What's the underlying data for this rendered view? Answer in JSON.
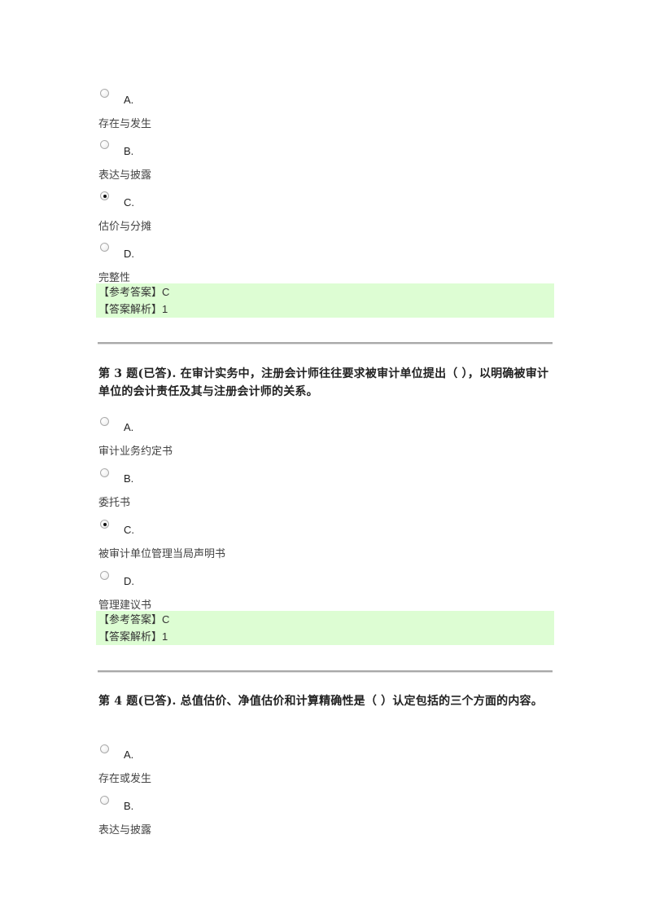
{
  "questions": [
    {
      "title": "",
      "options": [
        {
          "letter": "A.",
          "text": "存在与发生",
          "selected": false
        },
        {
          "letter": "B.",
          "text": "表达与披露",
          "selected": false
        },
        {
          "letter": "C.",
          "text": "估价与分摊",
          "selected": true
        },
        {
          "letter": "D.",
          "text": "完整性",
          "selected": false
        }
      ],
      "answer_label": "【参考答案】",
      "answer_value": "C",
      "analysis_label": "【答案解析】",
      "analysis_value": "1"
    },
    {
      "title": "第 3 题(已答). 在审计实务中，注册会计师往往要求被审计单位提出（ ），以明确被审计单位的会计责任及其与注册会计师的关系。",
      "options": [
        {
          "letter": "A.",
          "text": "审计业务约定书",
          "selected": false
        },
        {
          "letter": "B.",
          "text": "委托书",
          "selected": false
        },
        {
          "letter": "C.",
          "text": "被审计单位管理当局声明书",
          "selected": true
        },
        {
          "letter": "D.",
          "text": "管理建议书",
          "selected": false
        }
      ],
      "answer_label": "【参考答案】",
      "answer_value": "C",
      "analysis_label": "【答案解析】",
      "analysis_value": "1"
    },
    {
      "title": "第 4 题(已答). 总值估价、净值估价和计算精确性是（ ）认定包括的三个方面的内容。",
      "options": [
        {
          "letter": "A.",
          "text": "存在或发生",
          "selected": false
        },
        {
          "letter": "B.",
          "text": "表达与披露",
          "selected": false
        }
      ]
    }
  ],
  "colors": {
    "answer_background": "#ddfdd3",
    "divider": "#a9a9a9"
  }
}
